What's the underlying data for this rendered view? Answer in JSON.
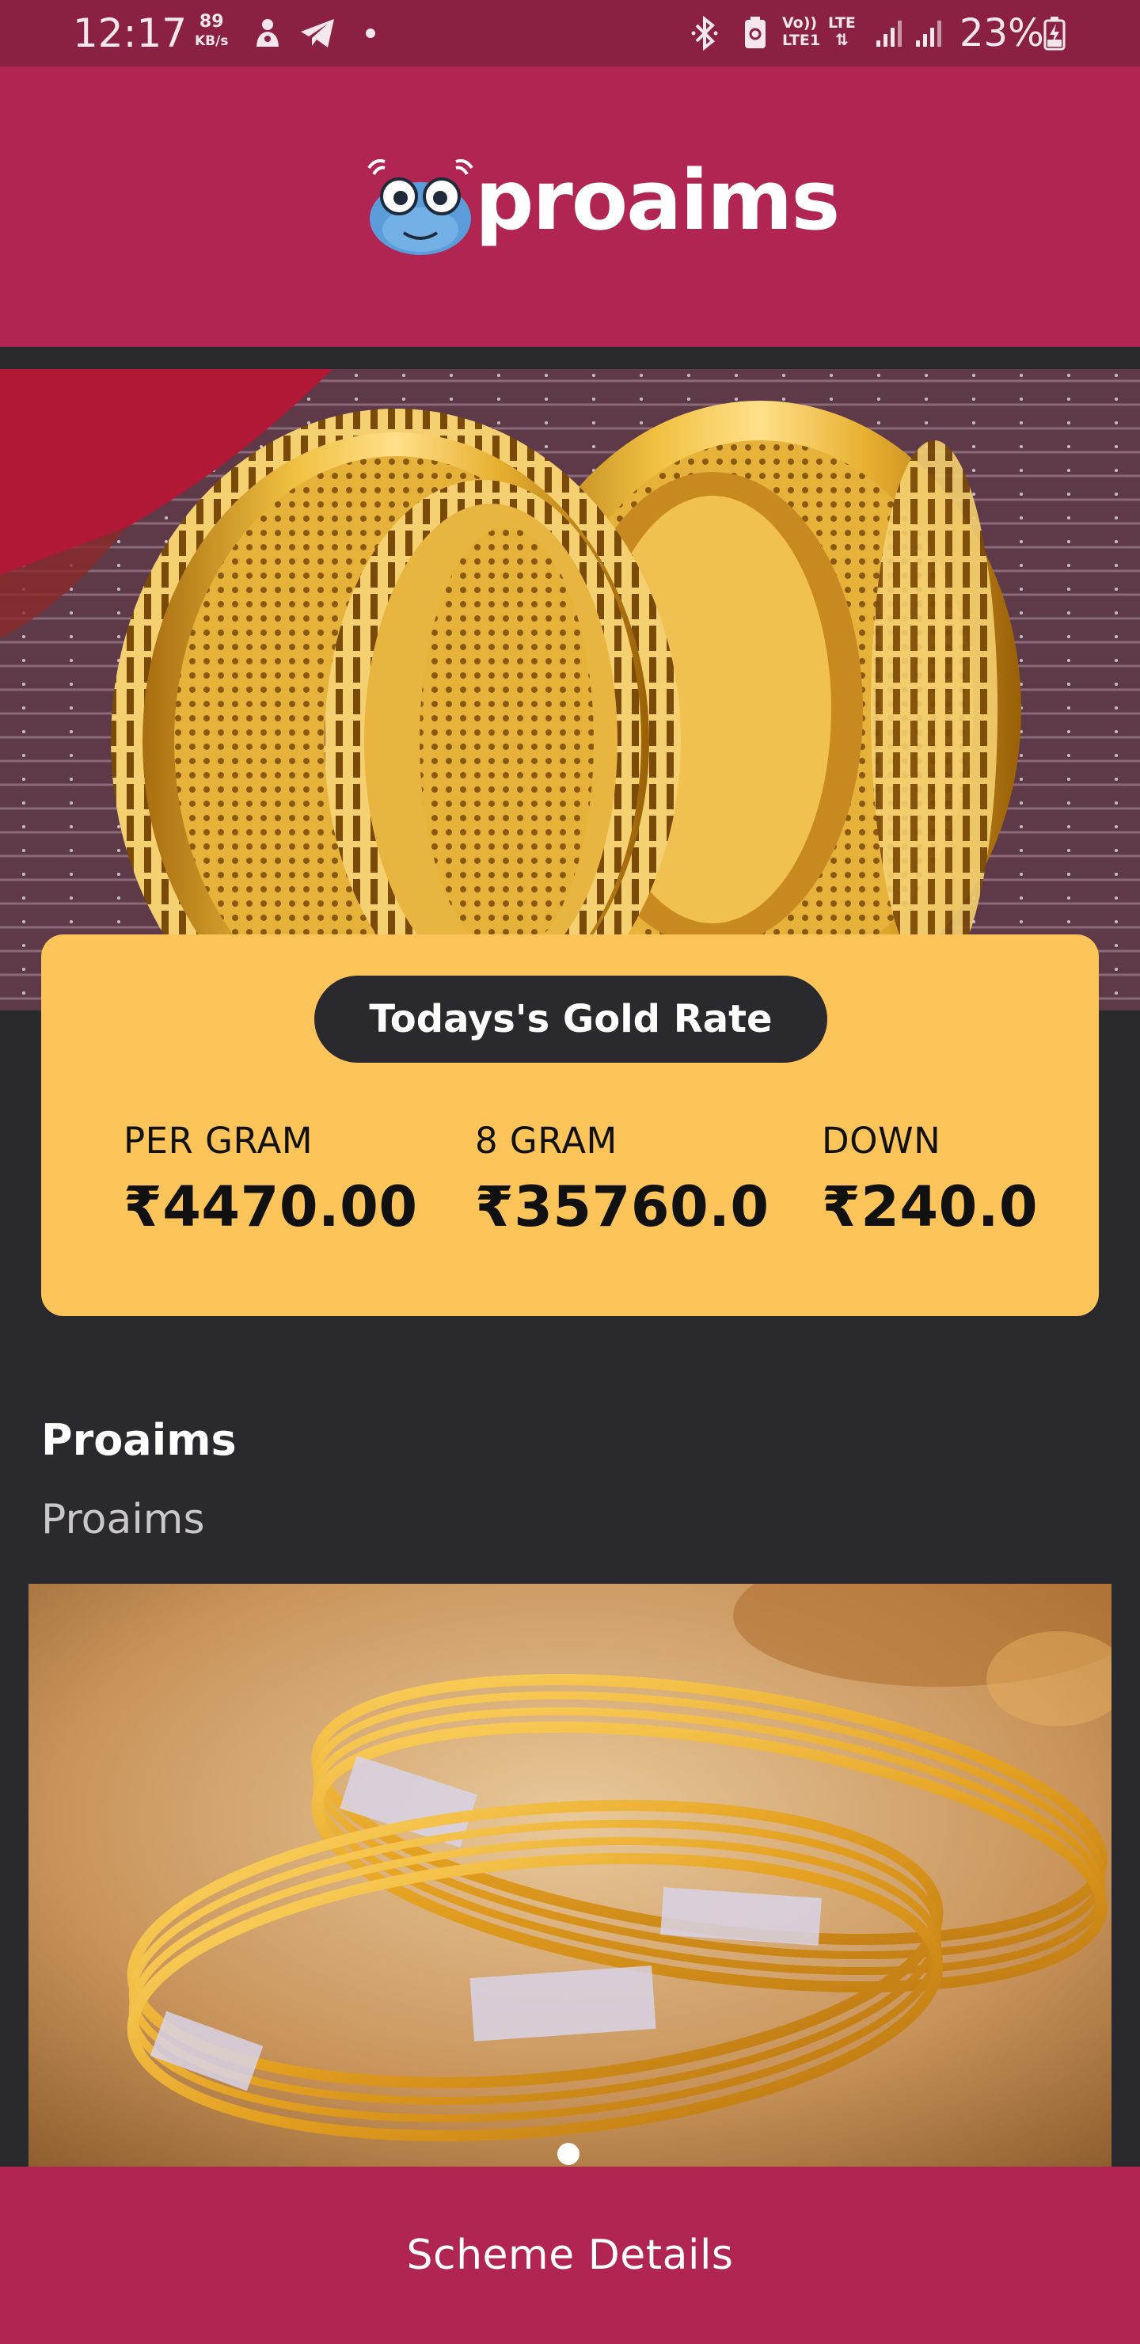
{
  "status_bar": {
    "time": "12:17",
    "net_speed_value": "89",
    "net_speed_unit": "KB/s",
    "volte": "Vo))",
    "lte1": "LTE1",
    "lte": "LTE",
    "battery": "23%"
  },
  "header": {
    "brand": "proaims"
  },
  "gold_rate": {
    "title": "Todays's Gold Rate",
    "items": [
      {
        "label": "PER GRAM",
        "value": "₹4470.00"
      },
      {
        "label": "8 GRAM",
        "value": "₹35760.0"
      },
      {
        "label": "DOWN",
        "value": "₹240.0"
      }
    ]
  },
  "section": {
    "title": "Proaims",
    "subtitle": "Proaims"
  },
  "footer": {
    "button_label": "Scheme Details"
  },
  "colors": {
    "status_bar": "#8a2042",
    "brand": "#b02552",
    "card": "#fdc45a",
    "background": "#2a292d"
  }
}
